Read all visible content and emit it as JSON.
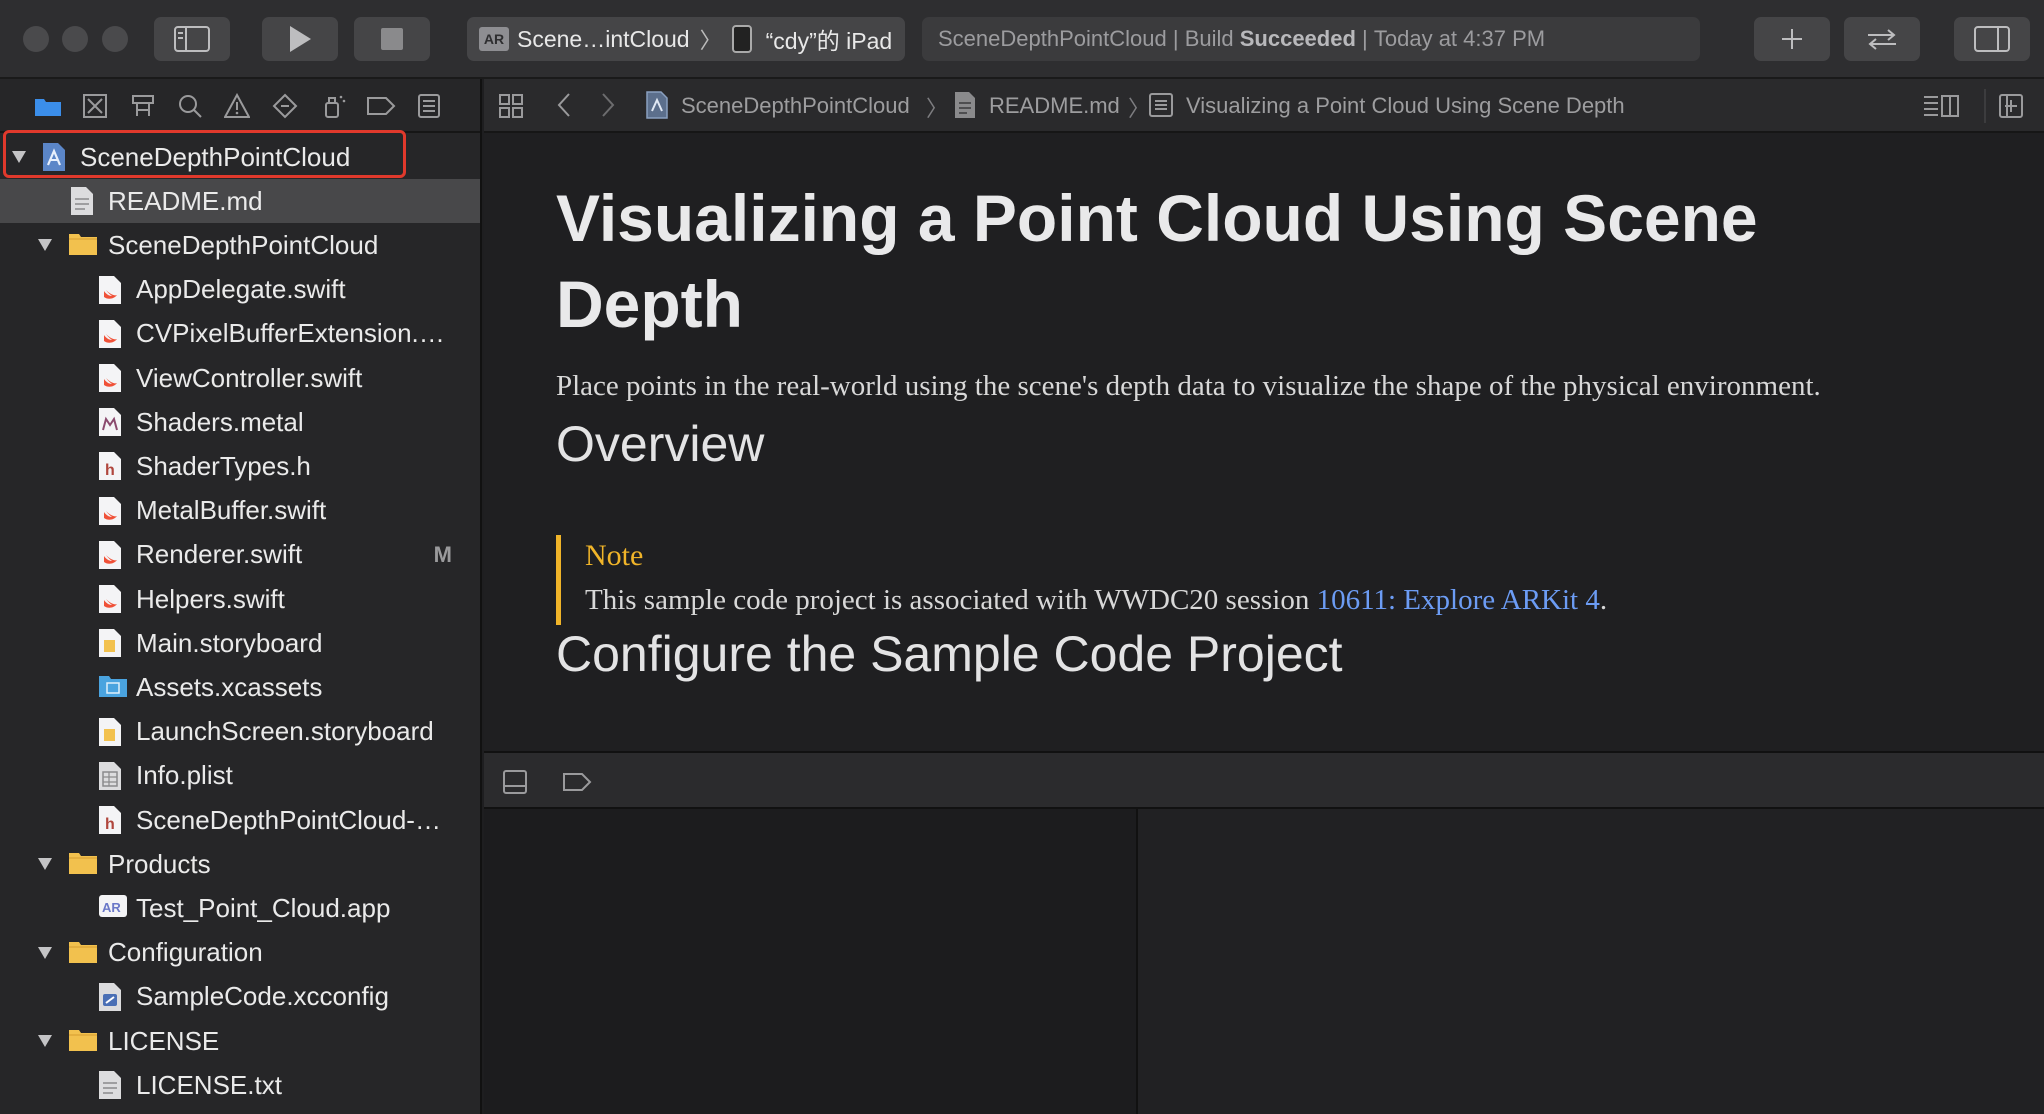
{
  "toolbar": {
    "scheme_name": "Scene…intCloud",
    "destination": "“cdy”的 iPad",
    "activity_project": "SceneDepthPointCloud",
    "activity_build_prefix": "Build",
    "activity_build_status": "Succeeded",
    "activity_time": "Today at 4:37 PM",
    "separator": "|"
  },
  "navigator": {
    "tabs": [
      "folder-icon",
      "source-control-icon",
      "symbol-icon",
      "find-icon",
      "issue-icon",
      "test-icon",
      "debug-icon",
      "breakpoint-icon",
      "report-icon"
    ],
    "items": [
      {
        "label": "SceneDepthPointCloud",
        "type": "project",
        "depth": 0,
        "disclosure": true
      },
      {
        "label": "README.md",
        "type": "doc",
        "depth": 1,
        "selected": true
      },
      {
        "label": "SceneDepthPointCloud",
        "type": "folder",
        "depth": 1,
        "disclosure": true
      },
      {
        "label": "AppDelegate.swift",
        "type": "swift",
        "depth": 2
      },
      {
        "label": "CVPixelBufferExtension.…",
        "type": "swift",
        "depth": 2
      },
      {
        "label": "ViewController.swift",
        "type": "swift",
        "depth": 2
      },
      {
        "label": "Shaders.metal",
        "type": "metal",
        "depth": 2
      },
      {
        "label": "ShaderTypes.h",
        "type": "header",
        "depth": 2
      },
      {
        "label": "MetalBuffer.swift",
        "type": "swift",
        "depth": 2
      },
      {
        "label": "Renderer.swift",
        "type": "swift",
        "depth": 2,
        "badge": "M"
      },
      {
        "label": "Helpers.swift",
        "type": "swift",
        "depth": 2
      },
      {
        "label": "Main.storyboard",
        "type": "storyboard",
        "depth": 2
      },
      {
        "label": "Assets.xcassets",
        "type": "assets",
        "depth": 2
      },
      {
        "label": "LaunchScreen.storyboard",
        "type": "storyboard",
        "depth": 2
      },
      {
        "label": "Info.plist",
        "type": "plist",
        "depth": 2
      },
      {
        "label": "SceneDepthPointCloud-…",
        "type": "header",
        "depth": 2
      },
      {
        "label": "Products",
        "type": "folder",
        "depth": 1,
        "disclosure": true
      },
      {
        "label": "Test_Point_Cloud.app",
        "type": "app",
        "depth": 2
      },
      {
        "label": "Configuration",
        "type": "folder",
        "depth": 1,
        "disclosure": true
      },
      {
        "label": "SampleCode.xcconfig",
        "type": "config",
        "depth": 2
      },
      {
        "label": "LICENSE",
        "type": "folder",
        "depth": 1,
        "disclosure": true
      },
      {
        "label": "LICENSE.txt",
        "type": "doc",
        "depth": 2
      }
    ]
  },
  "jumpbar": {
    "crumbs": [
      "SceneDepthPointCloud",
      "README.md",
      "Visualizing a Point Cloud Using Scene Depth"
    ]
  },
  "document": {
    "title": "Visualizing a Point Cloud Using Scene Depth",
    "abstract": "Place points in the real-world using the scene's depth data to visualize the shape of the physical environment.",
    "overview_heading": "Overview",
    "note_title": "Note",
    "note_text_prefix": "This sample code project is associated with WWDC20 session ",
    "note_link": "10611: Explore ARKit 4",
    "note_text_suffix": ".",
    "configure_heading": "Configure the Sample Code Project"
  },
  "colors": {
    "accent_note": "#f0b429",
    "link": "#6c9cf4",
    "selection_outline": "#e0392c"
  }
}
